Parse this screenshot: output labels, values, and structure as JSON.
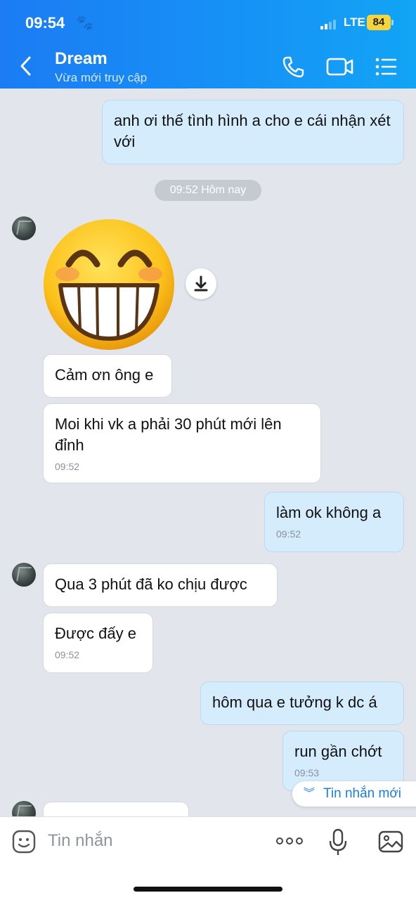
{
  "status_bar": {
    "time": "09:54",
    "network": "LTE",
    "battery": "84"
  },
  "header": {
    "title": "Dream",
    "subtitle": "Vừa mới truy cập"
  },
  "messages": {
    "m1": {
      "text": "anh ơi thế tình hình a cho e cái nhận xét với"
    },
    "date_pill": "09:52 Hôm nay",
    "m2": {
      "text": "Cảm ơn ông e"
    },
    "m3": {
      "text": "Moi khi vk a phải 30 phút mới lên đỉnh",
      "time": "09:52"
    },
    "m4": {
      "text": "làm ok không a",
      "time": "09:52"
    },
    "m5": {
      "text": "Qua 3 phút đã ko chịu được"
    },
    "m6": {
      "text": "Được đấy e",
      "time": "09:52"
    },
    "m7": {
      "text": "hôm qua e tưởng k dc á"
    },
    "m8": {
      "text": "run gần chớt",
      "time": "09:53"
    }
  },
  "new_message_button": "Tin nhắn mới",
  "input": {
    "placeholder": "Tin nhắn"
  },
  "icons": {
    "back": "chevron-left-icon",
    "call": "phone-icon",
    "video": "video-camera-icon",
    "menu": "list-menu-icon",
    "sticker": "smiley-sticker",
    "download": "download-icon",
    "emoji": "emoji-icon",
    "more": "more-dots-icon",
    "mic": "microphone-icon",
    "image": "image-icon"
  },
  "colors": {
    "header": "#1b7cf4",
    "outgoing_bubble": "#d5ecfd",
    "incoming_bubble": "#ffffff",
    "accent": "#1a7df0",
    "battery": "#f6d43c"
  }
}
